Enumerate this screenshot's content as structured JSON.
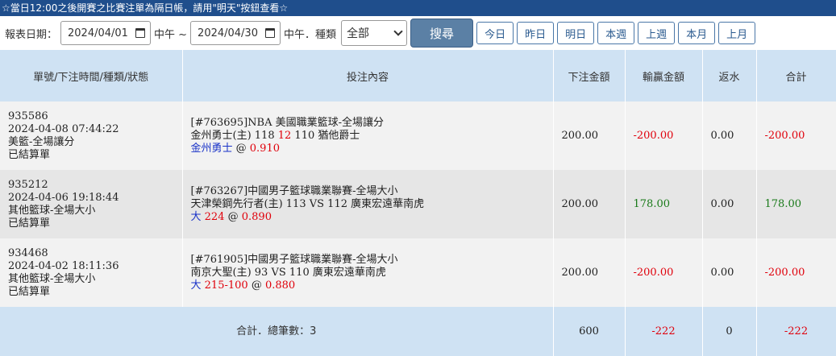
{
  "notice": "☆當日12:00之後開賽之比賽注單為隔日帳，請用\"明天\"按鈕查看☆",
  "filter": {
    "date_label": "報表日期：",
    "start_date": "2024/04/01",
    "start_suffix": "中午 ~",
    "end_date": "2024/04/30",
    "end_suffix": "中午．種類",
    "category": "全部",
    "search_label": "搜尋",
    "quick": [
      "今日",
      "昨日",
      "明日",
      "本週",
      "上週",
      "本月",
      "上月"
    ]
  },
  "columns": [
    "單號/下注時間/種類/狀態",
    "投注內容",
    "下注金額",
    "輸贏金額",
    "返水",
    "合計"
  ],
  "rows": [
    {
      "id": "935586",
      "time": "2024-04-08 07:44:22",
      "type": "美籃-全場讓分",
      "status": "已結算單",
      "event": "[#763695]NBA 美國職業籃球-全場讓分",
      "match_home": "金州勇士(主) 118",
      "match_line": "12",
      "match_away": "110 猶他爵士",
      "pick": "金州勇士",
      "pick_line": "",
      "odds": "0.910",
      "stake": "200.00",
      "winloss": "-200.00",
      "rebate": "0.00",
      "total": "-200.00"
    },
    {
      "id": "935212",
      "time": "2024-04-06 19:18:44",
      "type": "其他籃球-全場大小",
      "status": "已結算單",
      "event": "[#763267]中國男子籃球職業聯賽-全場大小",
      "match_home": "天津榮鋼先行者(主) 113",
      "match_line": "VS",
      "match_away": "112 廣東宏遠華南虎",
      "pick": "大",
      "pick_line": "224",
      "odds": "0.890",
      "stake": "200.00",
      "winloss": "178.00",
      "rebate": "0.00",
      "total": "178.00"
    },
    {
      "id": "934468",
      "time": "2024-04-02 18:11:36",
      "type": "其他籃球-全場大小",
      "status": "已結算單",
      "event": "[#761905]中國男子籃球職業聯賽-全場大小",
      "match_home": "南京大聖(主) 93",
      "match_line": "VS",
      "match_away": "110 廣東宏遠華南虎",
      "pick": "大",
      "pick_line": "215-100",
      "odds": "0.880",
      "stake": "200.00",
      "winloss": "-200.00",
      "rebate": "0.00",
      "total": "-200.00"
    }
  ],
  "summary": {
    "label": "合計．總筆數：3",
    "stake": "600",
    "winloss": "-222",
    "rebate": "0",
    "total": "-222"
  },
  "colors": {
    "header_bg": "#cfe2f3",
    "notice_bg": "#1f4e8c",
    "loss": "#e0000b",
    "win": "#1a7a1a",
    "pick": "#1a33c8"
  }
}
